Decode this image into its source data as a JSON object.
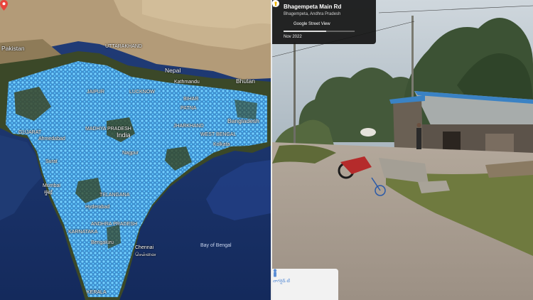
{
  "map": {
    "labels": {
      "pakistan": "Pakistan",
      "uttarakhand": "UTTARAKHAND",
      "nepal": "Nepal",
      "kathmandu": "Kathmandu",
      "bhutan": "Bhutan",
      "jaipur": "JAIPUR",
      "lucknow": "LUCKNOW",
      "patna": "PATNA",
      "bihar": "BIHAR",
      "bangladesh": "Bangladesh",
      "gujarat": "GUJARAT",
      "ahmedabad": "Ahmedabad",
      "madhya_pradesh": "MADHYA PRADESH",
      "india": "India",
      "jharkhand": "JHARKHAND",
      "west_bengal": "WEST BENGAL",
      "kolkata": "Kolkata",
      "surat": "Surat",
      "nagpur": "Nagpur",
      "mumbai": "Mumbai",
      "mumbai_local": "मुंबई",
      "telangana": "TELANGANA",
      "hyderabad": "Hyderabad",
      "karnataka": "KARNATAKA",
      "andhra_pradesh": "ANDHRA PRADESH",
      "bengaluru": "Bengaluru",
      "chennai": "Chennai",
      "chennai_local": "சென்னை",
      "bay_of_bengal": "Bay of Bengal",
      "kerala": "KERALA"
    },
    "colors": {
      "ocean": "#1d3a75",
      "coverage": "#49b6f2",
      "land": "#3d4a2a",
      "pin": "#e8453c"
    }
  },
  "street_view": {
    "road_title": "Bhagempeta Main Rd",
    "region": "Bhagempeta, Andhra Pradesh",
    "service_label": "Google Street View",
    "date": "Nov 2022",
    "back_icon": "arrow-left-icon",
    "minimap_text": "నాగర్షెడ్ టీ"
  }
}
